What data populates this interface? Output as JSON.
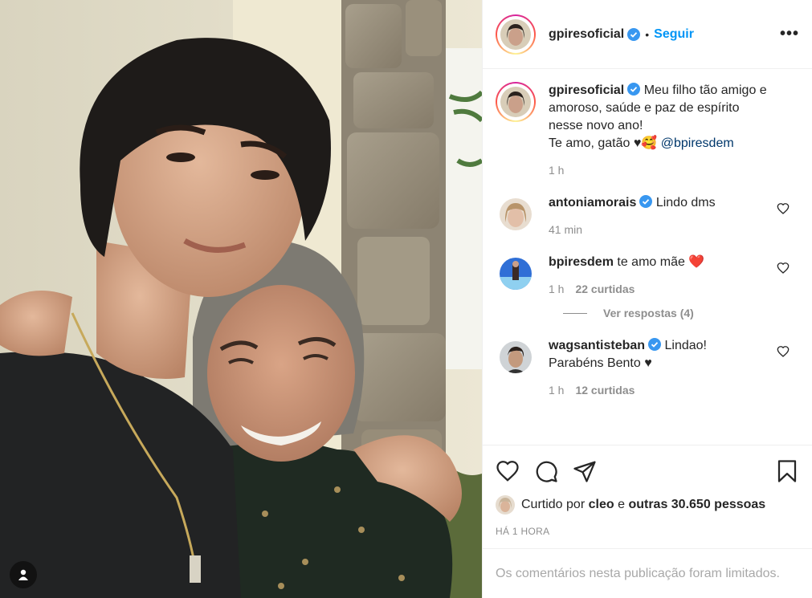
{
  "post": {
    "username": "gpiresoficial",
    "follow_label": "Seguir",
    "dot": "•",
    "more_label": "•••",
    "caption_lines": [
      "Meu filho tão amigo e",
      "amoroso, saúde e paz de espírito",
      "nesse novo ano!",
      "Te amo, gatão ♥🥰 "
    ],
    "caption_mention": "@bpiresdem",
    "caption_time": "1 h"
  },
  "comments": [
    {
      "username": "antoniamorais",
      "verified": true,
      "text": "Lindo dms",
      "time": "41 min"
    },
    {
      "username": "bpiresdem",
      "verified": false,
      "text": "te amo mãe ❤️",
      "time": "1 h",
      "likes": "22 curtidas",
      "replies_label": "Ver respostas (4)"
    },
    {
      "username": "wagsantisteban",
      "verified": true,
      "text_line1": "Lindao!",
      "text_line2": "Parabéns Bento ♥",
      "time": "1 h",
      "likes": "12 curtidas"
    }
  ],
  "likes": {
    "prefix": "Curtido por ",
    "user": "cleo",
    "middle": " e ",
    "others": "outras 30.650 pessoas"
  },
  "timestamp": "HÁ 1 HORA",
  "limited_text": "Os comentários nesta publicação foram limitados.",
  "icons": [
    "heart-icon",
    "comment-icon",
    "share-icon",
    "bookmark-icon",
    "more-icon",
    "user-tag-icon",
    "verified-icon"
  ],
  "colors": {
    "accent": "#0095f6",
    "verified": "#3897f0",
    "muted": "#8e8e8e",
    "mention": "#00376b",
    "heart_red": "#ed4956"
  }
}
